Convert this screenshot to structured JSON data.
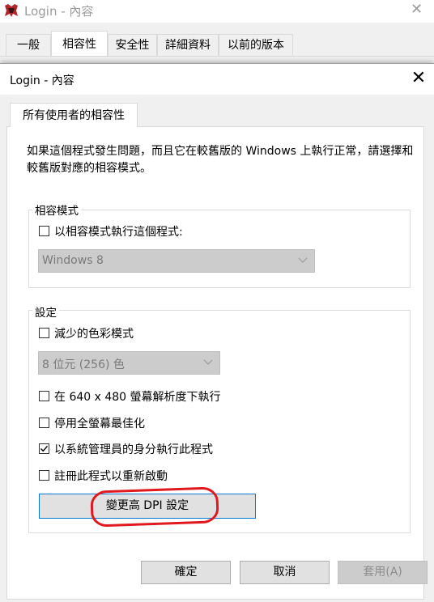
{
  "background_window": {
    "title": "Login - 內容",
    "close_glyph": "✕",
    "tabs": [
      "一般",
      "相容性",
      "安全性",
      "詳細資料",
      "以前的版本"
    ],
    "active_tab": "相容性"
  },
  "dialog": {
    "title": "Login - 內容",
    "close_glyph": "✕",
    "tab": "所有使用者的相容性",
    "intro_text": "如果這個程式發生問題，而且它在較舊版的 Windows 上執行正常，請選擇和較舊版對應的相容模式。",
    "compat_group": {
      "label": "相容模式",
      "checkbox_label": "以相容模式執行這個程式:",
      "checked": false,
      "select_value": "Windows 8"
    },
    "settings_group": {
      "label": "設定",
      "reduced_color": {
        "label": "減少的色彩模式",
        "checked": false
      },
      "color_select_value": "8 位元 (256) 色",
      "low_res": {
        "label": "在 640 x 480 螢幕解析度下執行",
        "checked": false
      },
      "disable_fullscreen": {
        "label": "停用全螢幕最佳化",
        "checked": false
      },
      "run_as_admin": {
        "label": "以系統管理員的身分執行此程式",
        "checked": true
      },
      "register_restart": {
        "label": "註冊此程式以重新啟動",
        "checked": false
      },
      "dpi_button": "變更高 DPI 設定"
    },
    "buttons": {
      "ok": "確定",
      "cancel": "取消",
      "apply": "套用(A)"
    }
  },
  "colors": {
    "focus_border": "#0078d7",
    "annotation": "#e0191f"
  },
  "icons": [
    "app-icon",
    "close-icon",
    "chevron-down-icon",
    "checkmark-icon"
  ]
}
